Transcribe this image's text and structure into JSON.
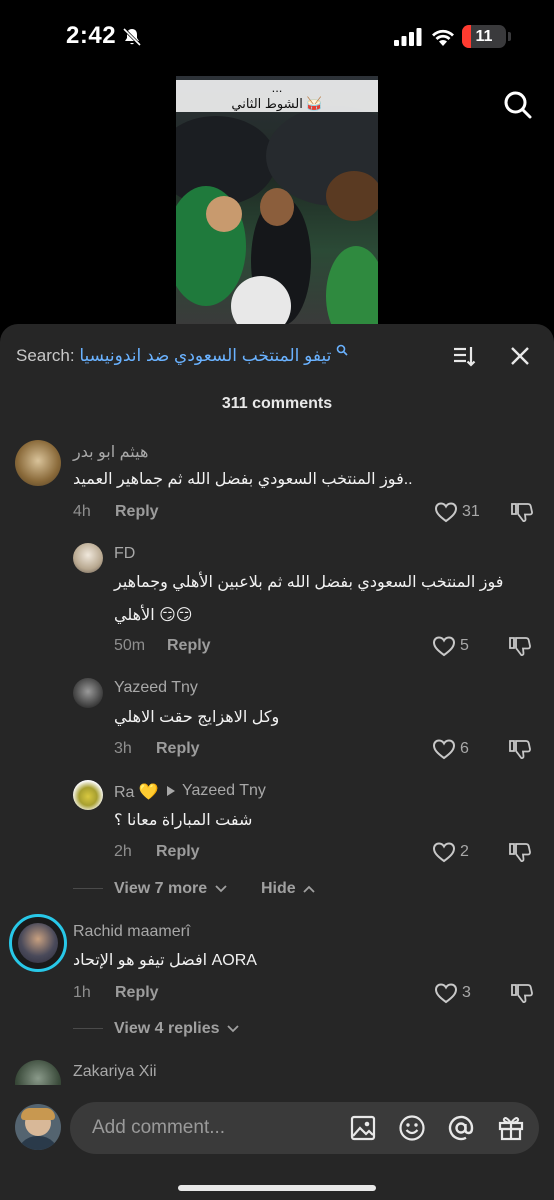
{
  "status_bar": {
    "time": "2:42",
    "battery": "11"
  },
  "video": {
    "caption_line1": "...",
    "caption_line2": "الشوط الثاني 🥁"
  },
  "search": {
    "prefix": "Search:",
    "query": "تيفو المنتخب السعودي ضد اندونيسيا"
  },
  "comments_count": "311 comments",
  "comments": [
    {
      "user": "هيثم ابو بدر",
      "text": "فوز المنتخب السعودي بفضل الله ثم جماهير العميد..",
      "time": "4h",
      "reply": "Reply",
      "likes": "31"
    },
    {
      "user": "FD",
      "text_line1": "فوز المنتخب السعودي بفضل الله ثم بلاعبين الأهلي وجماهير",
      "text_line2": "الأهلي 😏😏",
      "time": "50m",
      "reply": "Reply",
      "likes": "5"
    },
    {
      "user": "Yazeed Tny",
      "text": "وكل الاهزايج حقت الاهلي",
      "time": "3h",
      "reply": "Reply",
      "likes": "6"
    },
    {
      "user": "Ra 💛",
      "reply_to": "Yazeed Tny",
      "text": "شفت المباراة معانا ؟",
      "time": "2h",
      "reply": "Reply",
      "likes": "2"
    },
    {
      "user": "Rachid maamerî",
      "text": "افضل تيفو هو الإتحاد AORA",
      "time": "1h",
      "reply": "Reply",
      "likes": "3"
    },
    {
      "user": "Zakariya Xii"
    }
  ],
  "view_more": "View 7 more",
  "hide": "Hide",
  "view_replies": "View 4 replies",
  "input": {
    "placeholder": "Add comment..."
  },
  "colors": {
    "sheet_bg": "#262626",
    "query_link": "#6ab2ff",
    "battery_low": "#ff3b30"
  }
}
